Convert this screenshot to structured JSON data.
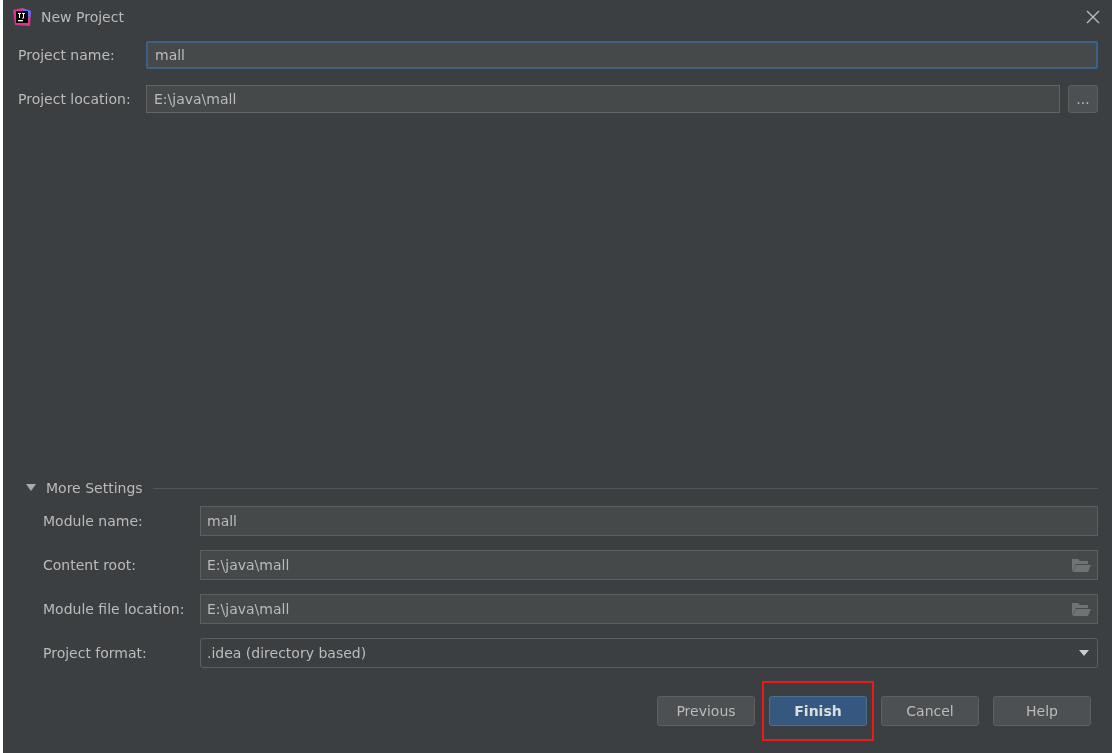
{
  "window": {
    "title": "New Project"
  },
  "project_fields": [
    {
      "label": "Project name:",
      "value": "mall",
      "focused": true
    },
    {
      "label": "Project location:",
      "value": "E:\\java\\mall",
      "focused": false,
      "browse_button": "..."
    }
  ],
  "more_settings": {
    "title": "More Settings",
    "expanded": true,
    "fields": [
      {
        "kind": "text",
        "label": "Module name:",
        "value": "mall"
      },
      {
        "kind": "folder",
        "label": "Content root:",
        "value": "E:\\java\\mall"
      },
      {
        "kind": "folder",
        "label": "Module file location:",
        "value": "E:\\java\\mall"
      },
      {
        "kind": "dropdown",
        "label": "Project format:",
        "value": ".idea (directory based)"
      }
    ]
  },
  "buttons": [
    {
      "label": "Previous",
      "default": false,
      "annotated": false
    },
    {
      "label": "Finish",
      "default": true,
      "annotated": true
    },
    {
      "label": "Cancel",
      "default": false,
      "annotated": false
    },
    {
      "label": "Help",
      "default": false,
      "annotated": false
    }
  ]
}
